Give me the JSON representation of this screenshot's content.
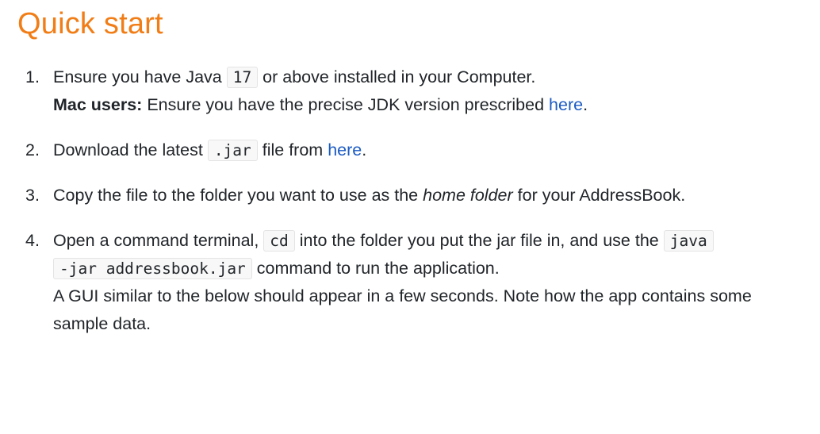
{
  "title": "Quick start",
  "steps": [
    {
      "number": "1.",
      "pre": "Ensure you have Java ",
      "code": "17",
      "post": " or above installed in your Computer.",
      "note_bold": "Mac users:",
      "note_text": " Ensure you have the precise JDK version prescribed ",
      "note_link": "here",
      "note_end": "."
    },
    {
      "number": "2.",
      "pre": "Download the latest ",
      "code": ".jar",
      "mid": " file from ",
      "link": "here",
      "end": "."
    },
    {
      "number": "3.",
      "pre": "Copy the file to the folder you want to use as the ",
      "italic": "home folder",
      "post": " for your AddressBook."
    },
    {
      "number": "4.",
      "pre": "Open a command terminal, ",
      "code1": "cd",
      "mid": " into the folder you put the jar file in, and use the ",
      "code2_line1": "java",
      "code2_line2": "-jar addressbook.jar",
      "post": " command to run the application.",
      "note": "A GUI similar to the below should appear in a few seconds. Note how the app contains some sample data."
    }
  ]
}
